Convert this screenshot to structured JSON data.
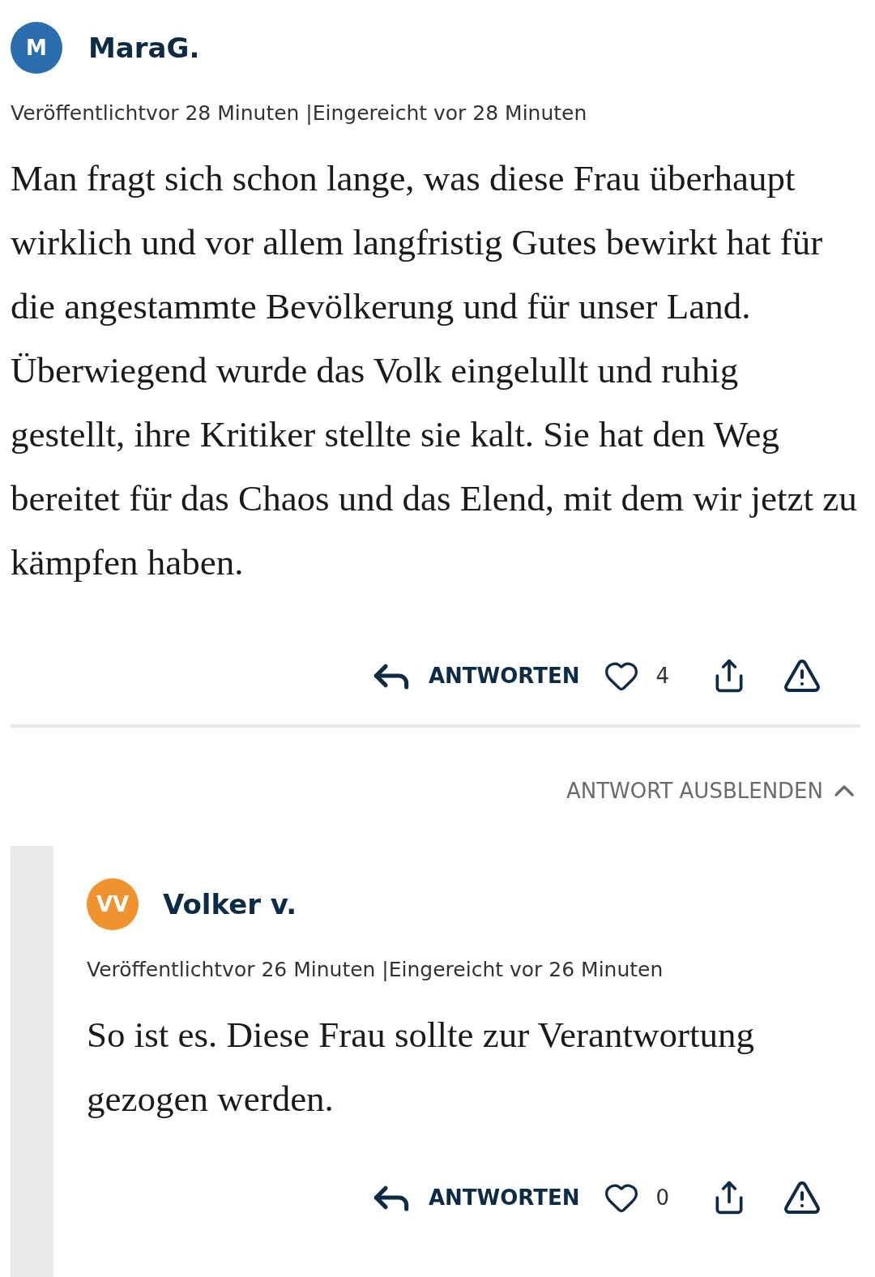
{
  "comment": {
    "avatar": {
      "initials": "M",
      "color": "#2a6eae"
    },
    "author": "MaraG.",
    "meta": "Veröffentlichtvor 28 Minuten |Eingereicht vor 28 Minuten",
    "text": "Man fragt sich schon lange, was diese Frau überhaupt wirklich und vor allem langfristig Gutes bewirkt hat für die angestammte Bevölkerung und für unser Land. Überwiegend wurde das Volk eingelullt und ruhig gestellt, ihre Kritiker stellte sie kalt. Sie hat den Weg bereitet für das Chaos und das Elend, mit dem wir jetzt zu kämpfen haben.",
    "reply_label": "ANTWORTEN",
    "likes": "4",
    "liked": false
  },
  "replies_toggle": {
    "label": "ANTWORT AUSBLENDEN",
    "expanded": true
  },
  "replies": [
    {
      "avatar": {
        "initials": "VV",
        "color": "#f0922e"
      },
      "author": "Volker v.",
      "meta": "Veröffentlichtvor 26 Minuten |Eingereicht vor 26 Minuten",
      "text": "So ist es. Diese Frau sollte zur Verantwortung gezogen werden.",
      "reply_label": "ANTWORTEN",
      "likes": "0",
      "liked": false
    }
  ]
}
